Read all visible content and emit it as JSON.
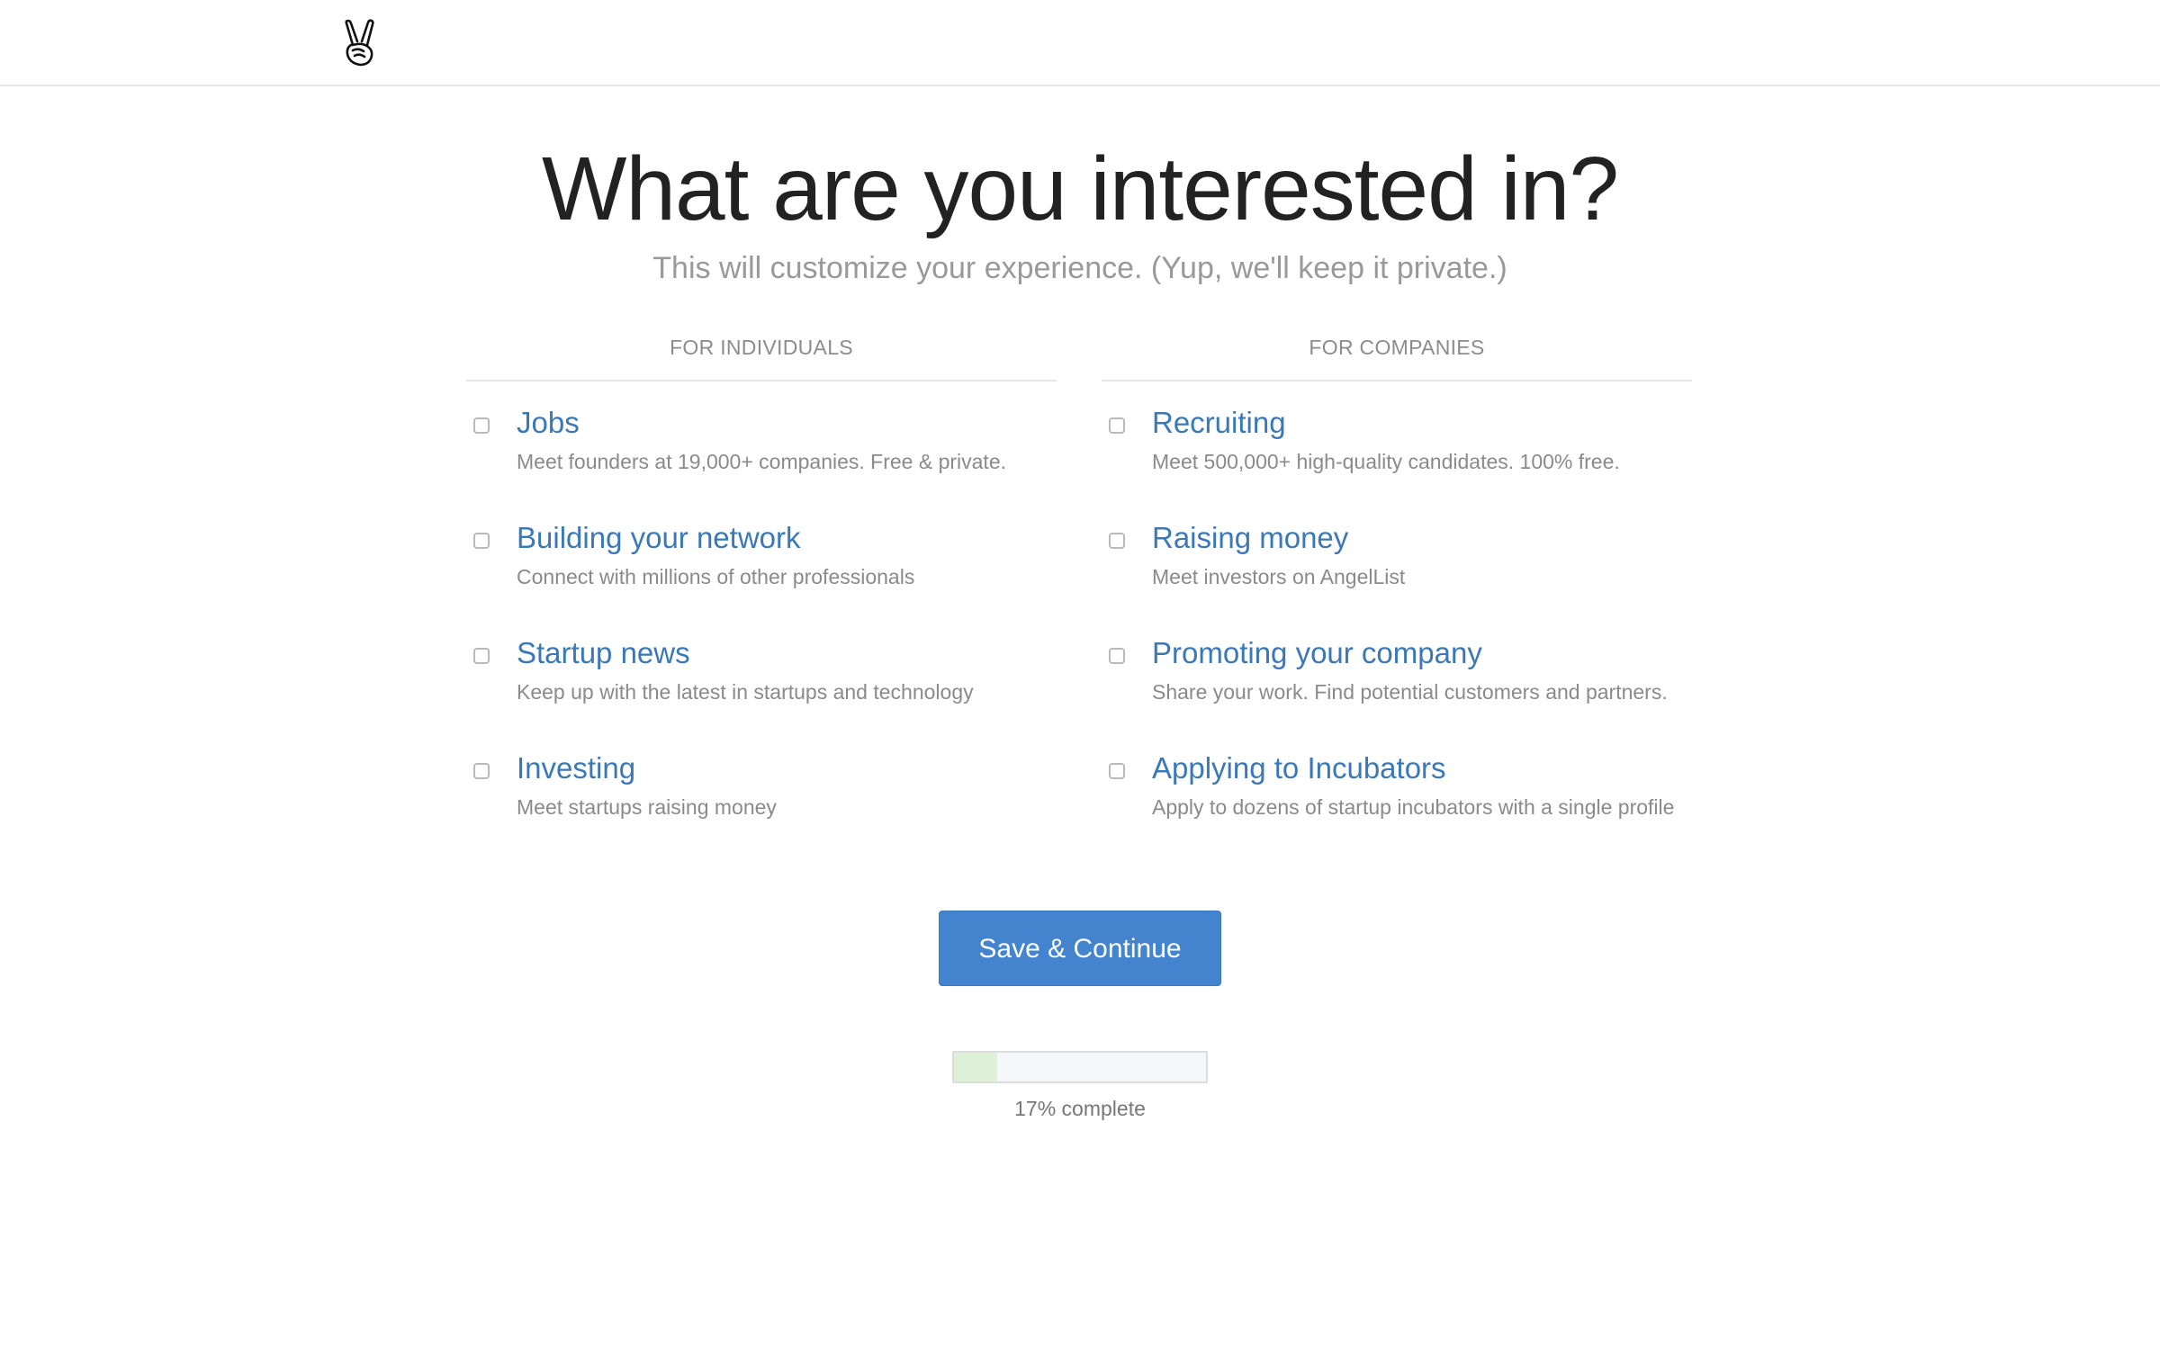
{
  "header": {
    "logo_icon": "peace-hand-icon"
  },
  "main": {
    "title": "What are you interested in?",
    "subtitle": "This will customize your experience. (Yup, we'll keep it private.)"
  },
  "individuals": {
    "header": "FOR INDIVIDUALS",
    "options": [
      {
        "title": "Jobs",
        "description": "Meet founders at 19,000+ companies. Free & private.",
        "checked": false
      },
      {
        "title": "Building your network",
        "description": "Connect with millions of other professionals",
        "checked": false
      },
      {
        "title": "Startup news",
        "description": "Keep up with the latest in startups and technology",
        "checked": false
      },
      {
        "title": "Investing",
        "description": "Meet startups raising money",
        "checked": false
      }
    ]
  },
  "companies": {
    "header": "FOR COMPANIES",
    "options": [
      {
        "title": "Recruiting",
        "description": "Meet 500,000+ high-quality candidates. 100% free.",
        "checked": false
      },
      {
        "title": "Raising money",
        "description": "Meet investors on AngelList",
        "checked": false
      },
      {
        "title": "Promoting your company",
        "description": "Share your work. Find potential customers and partners.",
        "checked": false
      },
      {
        "title": "Applying to Incubators",
        "description": "Apply to dozens of startup incubators with a single profile",
        "checked": false
      }
    ]
  },
  "actions": {
    "save_label": "Save & Continue"
  },
  "progress": {
    "percent": 17,
    "label": "17% complete"
  },
  "colors": {
    "link": "#3b78b8",
    "button": "#4484ce",
    "progress_fill": "#dff0d8"
  }
}
